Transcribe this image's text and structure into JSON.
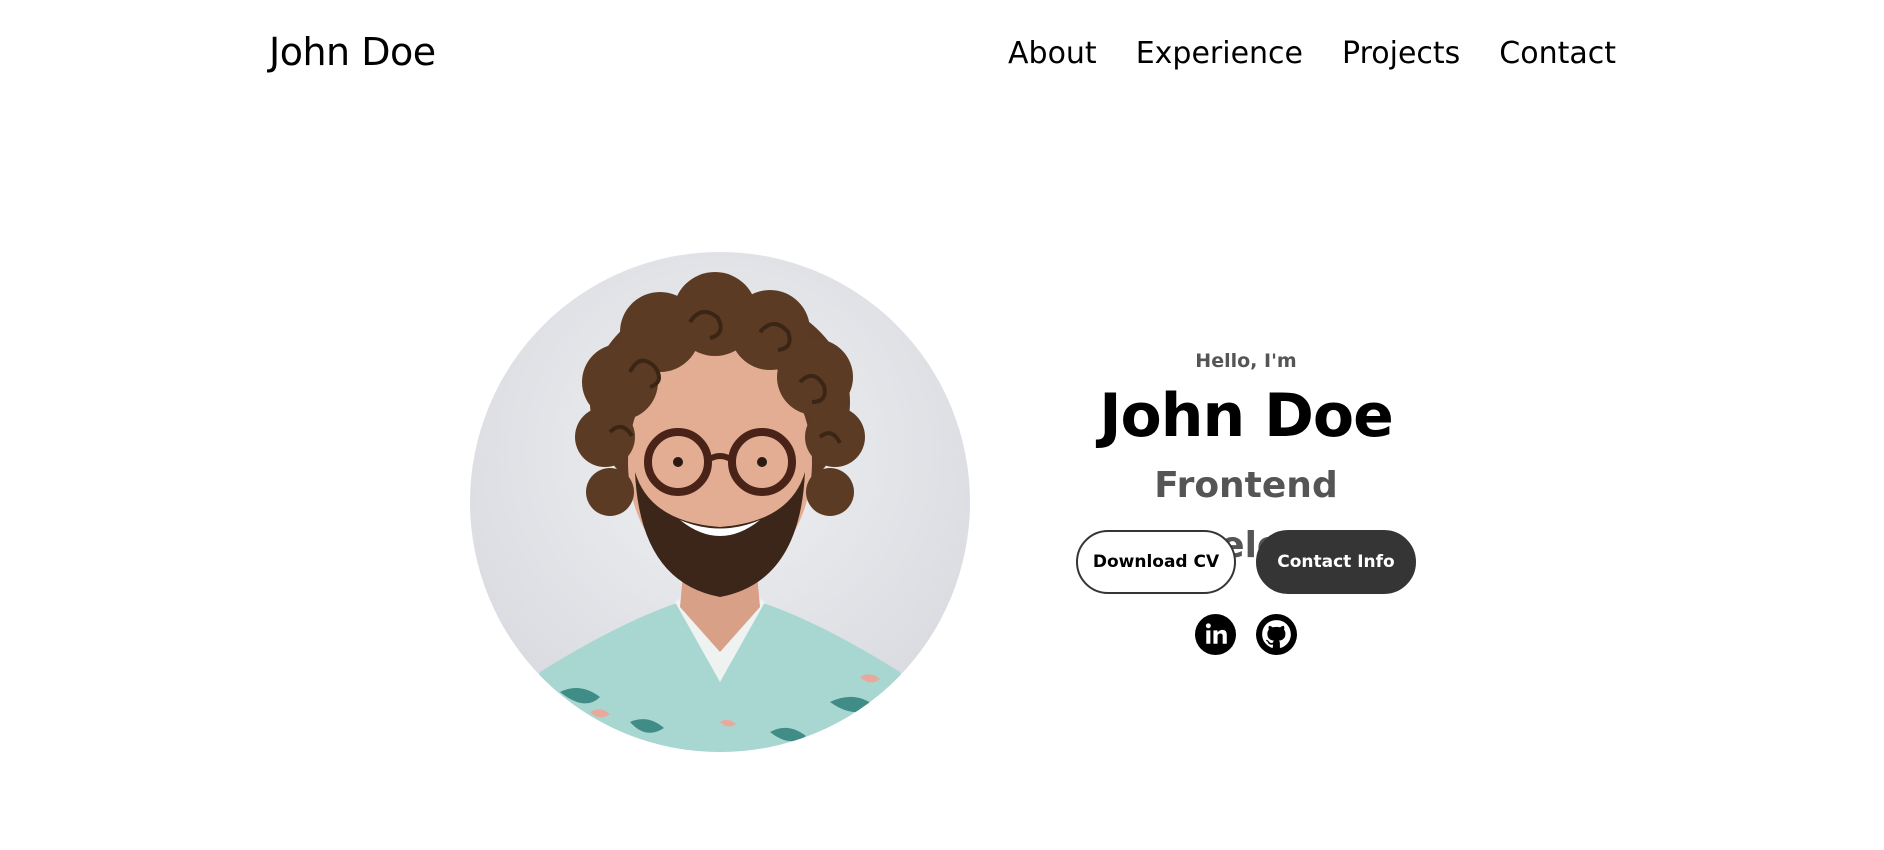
{
  "nav": {
    "logo": "John Doe",
    "links": [
      "About",
      "Experience",
      "Projects",
      "Contact"
    ]
  },
  "hero": {
    "greeting": "Hello, I'm",
    "name": "John Doe",
    "title": "Frontend Developer",
    "buttons": {
      "download_cv": "Download CV",
      "contact_info": "Contact Info"
    },
    "social": {
      "linkedin_icon": "linkedin-icon",
      "github_icon": "github-icon"
    }
  },
  "colors": {
    "text_primary": "#000000",
    "text_secondary": "#555555",
    "button_dark": "#353535",
    "background": "#ffffff"
  }
}
